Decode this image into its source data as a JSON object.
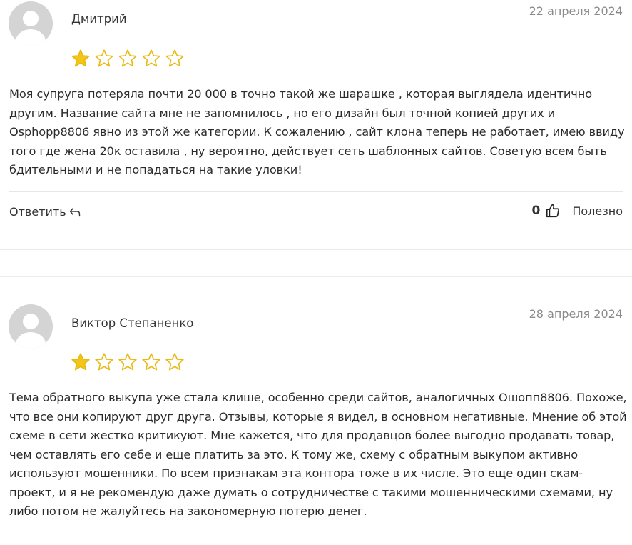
{
  "reviews": [
    {
      "author": "Дмитрий",
      "date": "22 апреля 2024",
      "rating": 1,
      "max_rating": 5,
      "text": "Моя супруга потеряла почти 20 000 в точно такой же шарашке , которая выглядела идентично другим. Название сайта мне не запомнилось , но его дизайн был точной копией других и Osphopp8806 явно из этой же категории. К сожалению , сайт клона теперь не работает, имею ввиду того где жена 20к оставила , ну вероятно, действует сеть шаблонных сайтов. Советую всем быть бдительными и не попадаться на такие уловки!",
      "reply_label": "Ответить",
      "helpful_count": "0",
      "helpful_label": "Полезно"
    },
    {
      "author": "Виктор Степаненко",
      "date": "28 апреля 2024",
      "rating": 1,
      "max_rating": 5,
      "text": "Тема обратного выкупа уже стала клише, особенно среди сайтов, аналогичных Ошопп8806. Похоже, что все они копируют друг друга. Отзывы, которые я видел, в основном негативные. Мнение об этой схеме в сети жестко критикуют. Мне кажется, что для продавцов более выгодно продавать товар, чем оставлять его себе и еще платить за это. К тому же, схему с обратным выкупом активно используют мошенники. По всем признакам эта контора тоже в их числе. Это еще один скам-проект, и я не рекомендую даже думать о сотрудничестве с такими мошенническими схемами, ну либо потом не жалуйтесь на закономерную потерю денег."
    }
  ],
  "colors": {
    "star_fill": "#f2c518",
    "star_outline": "#e8b90f",
    "avatar_bg": "#d4d4d4",
    "avatar_fg": "#ffffff"
  },
  "icons": {
    "avatar": "user-silhouette-icon",
    "star_filled": "star-filled-icon",
    "star_empty": "star-outline-icon",
    "reply": "reply-arrow-icon",
    "helpful": "thumbs-up-icon"
  }
}
